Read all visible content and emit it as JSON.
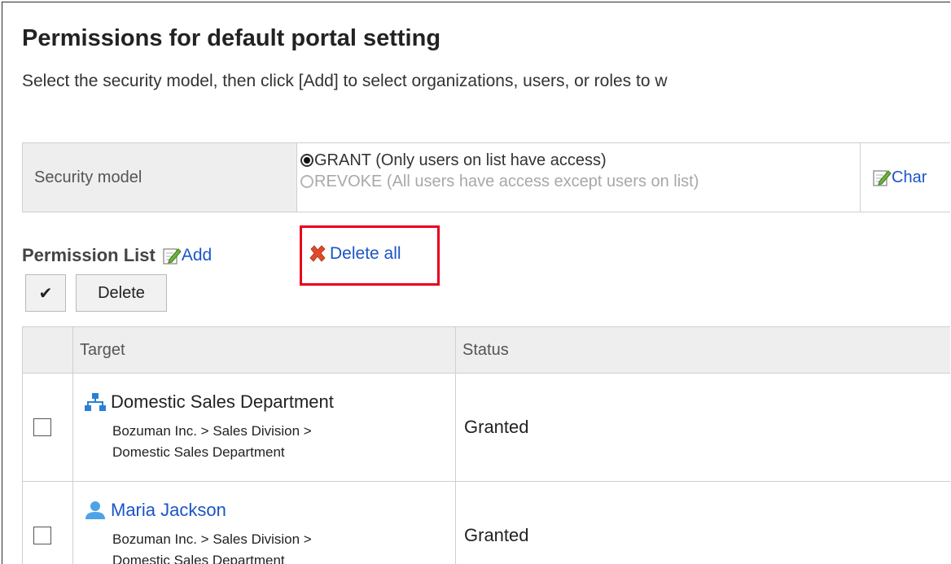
{
  "header": {
    "title": "Permissions for default portal setting",
    "description": "Select the security model, then click [Add] to select organizations, users, or roles to w"
  },
  "security": {
    "label": "Security model",
    "options": [
      {
        "label": "GRANT (Only users on list have access)",
        "selected": true
      },
      {
        "label": "REVOKE (All users have access except users on list)",
        "selected": false
      }
    ],
    "change_label": "Char"
  },
  "permission_list": {
    "title": "Permission List",
    "add_label": "Add",
    "delete_all_label": "Delete all",
    "check_all_label": "✔",
    "delete_label": "Delete",
    "columns": [
      "Target",
      "Status"
    ],
    "rows": [
      {
        "name": "Domestic Sales Department",
        "type": "organization",
        "path": "Bozuman Inc. > Sales Division >",
        "path2": "Domestic Sales Department",
        "status": "Granted"
      },
      {
        "name": "Maria Jackson",
        "type": "user",
        "path": "Bozuman Inc. > Sales Division >",
        "path2": "Domestic Sales Department",
        "status": "Granted"
      }
    ]
  },
  "colors": {
    "link": "#1a55c7",
    "highlight": "#e8001c",
    "header_bg": "#eeeeee"
  }
}
